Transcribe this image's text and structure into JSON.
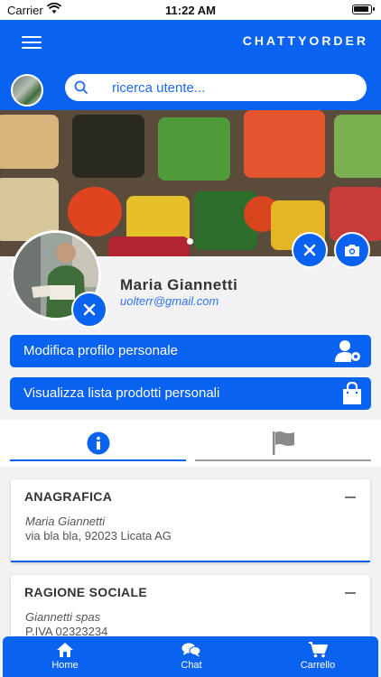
{
  "status_bar": {
    "carrier": "Carrier",
    "time": "11:22 AM"
  },
  "header": {
    "brand": "CHATTYORDER"
  },
  "search": {
    "placeholder": "ricerca utente..."
  },
  "profile": {
    "name": "Maria Giannetti",
    "email": "uolterr@gmail.com"
  },
  "actions": {
    "edit_profile": "Modifica profilo personale",
    "view_products": "Visualizza lista prodotti personali"
  },
  "tabs": [
    {
      "icon": "info-icon",
      "active": true
    },
    {
      "icon": "flag-icon",
      "active": false
    }
  ],
  "cards": [
    {
      "title": "ANAGRAFICA",
      "line1": "Maria Giannetti",
      "line2": "via bla bla, 92023 Licata AG"
    },
    {
      "title": "RAGIONE SOCIALE",
      "line1": "Giannetti spas",
      "line2": "P.IVA 02323234"
    }
  ],
  "bottom_nav": [
    {
      "label": "Home",
      "icon": "home-icon"
    },
    {
      "label": "Chat",
      "icon": "chat-icon"
    },
    {
      "label": "Carrello",
      "icon": "cart-icon"
    }
  ],
  "colors": {
    "primary": "#0a63f0",
    "background": "#f2f2f4",
    "link": "#2f73e8"
  }
}
